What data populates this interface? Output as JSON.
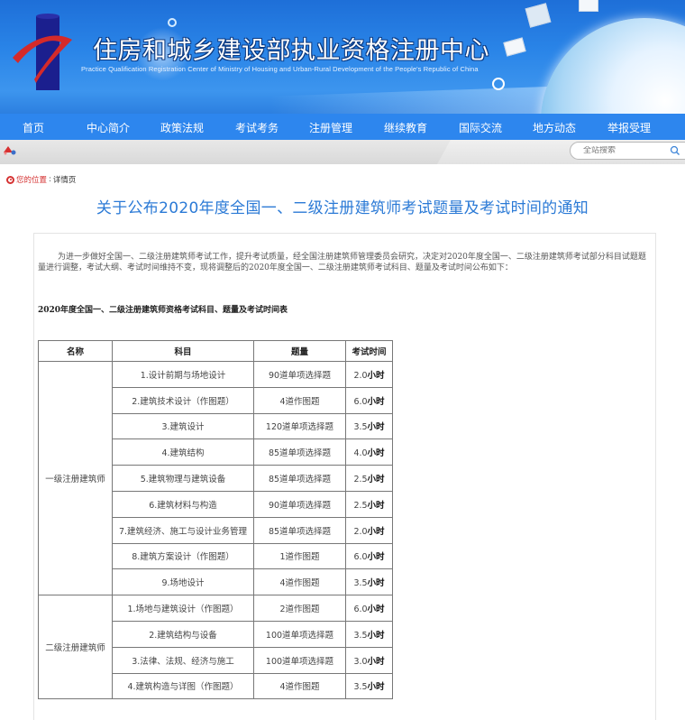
{
  "header": {
    "site_title": "住房和城乡建设部执业资格注册中心",
    "site_subtitle": "Practice Qualification Registration Center of Ministry of Housing and Urban-Rural Development of the People's Republic of China",
    "brand_colors": {
      "banner": "#2a85e8",
      "nav": "#2d86ee",
      "logo_red": "#d42a2a",
      "logo_blue": "#1a1f8c"
    }
  },
  "nav": {
    "items": [
      {
        "label": "首页"
      },
      {
        "label": "中心简介"
      },
      {
        "label": "政策法规"
      },
      {
        "label": "考试考务"
      },
      {
        "label": "注册管理"
      },
      {
        "label": "继续教育"
      },
      {
        "label": "国际交流"
      },
      {
        "label": "地方动态"
      },
      {
        "label": "举报受理"
      }
    ]
  },
  "search": {
    "placeholder": "全站搜索",
    "icon": "search-icon"
  },
  "breadcrumb": {
    "label": "您的位置",
    "separator": ":",
    "current": "详情页"
  },
  "article": {
    "title": "关于公布2020年度全国一、二级注册建筑师考试题量及考试时间的通知",
    "intro": "为进一步做好全国一、二级注册建筑师考试工作，提升考试质量，经全国注册建筑师管理委员会研究，决定对2020年度全国一、二级注册建筑师考试部分科目试题题量进行调整，考试大纲、考试时间维持不变，现将调整后的2020年度全国一、二级注册建筑师考试科目、题量及考试时间公布如下：",
    "table_caption": "2020年度全国一、二级注册建筑师资格考试科目、题量及考试时间表",
    "table": {
      "headers": [
        "名称",
        "科目",
        "题量",
        "考试时间"
      ],
      "hours_unit": "小时",
      "groups": [
        {
          "name": "一级注册建筑师",
          "rows": [
            {
              "subject": "1.设计前期与场地设计",
              "quantity": "90道单项选择题",
              "time": "2.0"
            },
            {
              "subject": "2.建筑技术设计（作图题）",
              "quantity": "4道作图题",
              "time": "6.0"
            },
            {
              "subject": "3.建筑设计",
              "quantity": "120道单项选择题",
              "time": "3.5"
            },
            {
              "subject": "4.建筑结构",
              "quantity": "85道单项选择题",
              "time": "4.0"
            },
            {
              "subject": "5.建筑物理与建筑设备",
              "quantity": "85道单项选择题",
              "time": "2.5"
            },
            {
              "subject": "6.建筑材料与构造",
              "quantity": "90道单项选择题",
              "time": "2.5"
            },
            {
              "subject": "7.建筑经济、施工与设计业务管理",
              "quantity": "85道单项选择题",
              "time": "2.0"
            },
            {
              "subject": "8.建筑方案设计（作图题）",
              "quantity": "1道作图题",
              "time": "6.0"
            },
            {
              "subject": "9.场地设计",
              "quantity": "4道作图题",
              "time": "3.5"
            }
          ]
        },
        {
          "name": "二级注册建筑师",
          "rows": [
            {
              "subject": "1.场地与建筑设计（作图题）",
              "quantity": "2道作图题",
              "time": "6.0"
            },
            {
              "subject": "2.建筑结构与设备",
              "quantity": "100道单项选择题",
              "time": "3.5"
            },
            {
              "subject": "3.法律、法规、经济与施工",
              "quantity": "100道单项选择题",
              "time": "3.0"
            },
            {
              "subject": "4.建筑构造与详图（作图题）",
              "quantity": "4道作图题",
              "time": "3.5"
            }
          ]
        }
      ]
    }
  }
}
